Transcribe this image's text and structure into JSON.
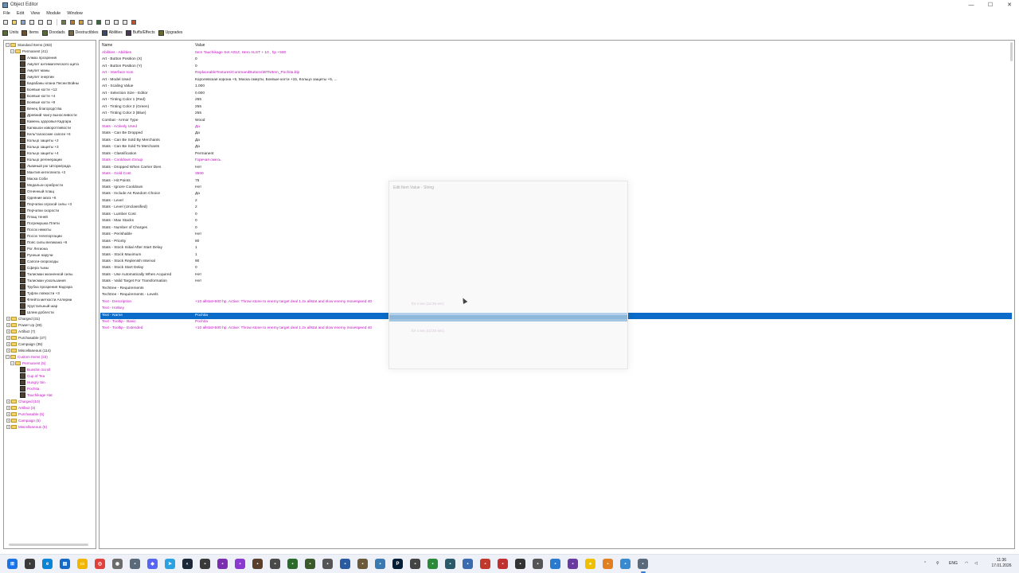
{
  "window": {
    "title": "Object Editor",
    "minimize": "—",
    "maximize": "☐",
    "close": "✕"
  },
  "menu": [
    "File",
    "Edit",
    "View",
    "Module",
    "Window"
  ],
  "object_tabs": [
    "Units",
    "Items",
    "Doodads",
    "Destructibles",
    "Abilities",
    "Buffs/Effects",
    "Upgrades"
  ],
  "tree": {
    "standard_root": "Standard Items (283)",
    "permanent_group": "Permanent (41)",
    "permanent_items": [
      "Алмаз прозрения",
      "Амулет антимагического щита",
      "Амулет маны",
      "Амулет энергии",
      "Барабаны клана Песни Войны",
      "Боевые когти +12",
      "Боевые когти +4",
      "Боевые когти +8",
      "Венец благородства",
      "Древний чангу выносливости",
      "Камень здоровья Кадгара",
      "Капюшон изворотливости",
      "Кель'таласские сапоги +6",
      "Кольцо защиты +2",
      "Кольцо защиты +3",
      "Кольцо защиты +4",
      "Кольцо регенерации",
      "Львиный рог Штормграда",
      "Мантия интеллекта +3",
      "Маска Соби",
      "Медальон храбрости",
      "Огненный плащ",
      "Одеяние мага +6",
      "Перчатки огрской силы +3",
      "Перчатки скорости",
      "Плащ теней",
      "Погремушка Плети",
      "Посох немоты",
      "Посох телепортации",
      "Пояс силы великана +6",
      "Рог Легиона",
      "Рунные наручи",
      "Сапоги-скороходы",
      "Сфера тьмы",
      "Талисман жизненной силы",
      "Талисман ускользания",
      "Трубка прозрения Кадгара",
      "Туфли ловкости +3",
      "Флейта меткости Аллерии",
      "Хрустальный шар",
      "Шлем доблести"
    ],
    "standard_groups": [
      "Charged (31)",
      "Power Up (28)",
      "Artifact (7)",
      "Purchasable (27)",
      "Campaign (35)",
      "Miscellaneous (114)"
    ],
    "custom_root": "Custom Items (33)",
    "custom_permanent": "Permanent (5)",
    "custom_items": [
      "Bunshin Scroll",
      "Cup of Tea",
      "Hungry Sin",
      "Pochita",
      "Tauchikage Hat"
    ],
    "custom_groups": [
      "Charged (10)",
      "Artifact (3)",
      "Purchasable (5)",
      "Campaign (5)",
      "Miscellaneous (5)"
    ]
  },
  "grid": {
    "col_name": "Name",
    "col_value": "Value",
    "rows": [
      {
        "name": "Abilities - Abilities",
        "value": "Item Tauchikage Set A01Z, Hero ALST + 10 , hp +500",
        "mod": true
      },
      {
        "name": "Art - Button Position (X)",
        "value": "0",
        "mod": false
      },
      {
        "name": "Art - Button Position (Y)",
        "value": "0",
        "mod": false
      },
      {
        "name": "Art - Interface Icon",
        "value": "ReplaceableTextures\\CommandButtons\\BTNItem_Pochita.blp",
        "mod": true
      },
      {
        "name": "Art - Model Used",
        "value": "Королевская корона +5, Маска смерти, Боевые когти +15, Кольцо защиты +5, ...",
        "mod": false
      },
      {
        "name": "Art - Scaling Value",
        "value": "1.000",
        "mod": false
      },
      {
        "name": "Art - Selection Size - Editor",
        "value": "0.000",
        "mod": false
      },
      {
        "name": "Art - Tinting Color 1 (Red)",
        "value": "255",
        "mod": false
      },
      {
        "name": "Art - Tinting Color 2 (Green)",
        "value": "255",
        "mod": false
      },
      {
        "name": "Art - Tinting Color 3 (Blue)",
        "value": "255",
        "mod": false
      },
      {
        "name": "Combat - Armor Type",
        "value": "Wood",
        "mod": false
      },
      {
        "name": "Stats - Actively Used",
        "value": "Да",
        "mod": true
      },
      {
        "name": "Stats - Can Be Dropped",
        "value": "Да",
        "mod": false
      },
      {
        "name": "Stats - Can Be Sold By Merchants",
        "value": "Да",
        "mod": false
      },
      {
        "name": "Stats - Can Be Sold To Merchants",
        "value": "Да",
        "mod": false
      },
      {
        "name": "Stats - Classification",
        "value": "Permanent",
        "mod": false
      },
      {
        "name": "Stats - Cooldown Group",
        "value": "Горечая смесь",
        "mod": true
      },
      {
        "name": "Stats - Dropped When Carrier Dies",
        "value": "Нет",
        "mod": false
      },
      {
        "name": "Stats - Gold Cost",
        "value": "3500",
        "mod": true
      },
      {
        "name": "Stats - Hit Points",
        "value": "75",
        "mod": false
      },
      {
        "name": "Stats - Ignore Cooldown",
        "value": "Нет",
        "mod": false
      },
      {
        "name": "Stats - Include As Random Choice",
        "value": "Да",
        "mod": false
      },
      {
        "name": "Stats - Level",
        "value": "2",
        "mod": false
      },
      {
        "name": "Stats - Level (Unclassified)",
        "value": "2",
        "mod": false
      },
      {
        "name": "Stats - Lumber Cost",
        "value": "0",
        "mod": false
      },
      {
        "name": "Stats - Max Stacks",
        "value": "0",
        "mod": false
      },
      {
        "name": "Stats - Number of Charges",
        "value": "0",
        "mod": false
      },
      {
        "name": "Stats - Perishable",
        "value": "Нет",
        "mod": false
      },
      {
        "name": "Stats - Priority",
        "value": "80",
        "mod": false
      },
      {
        "name": "Stats - Stock Initial After Start Delay",
        "value": "1",
        "mod": false
      },
      {
        "name": "Stats - Stock Maximum",
        "value": "1",
        "mod": false
      },
      {
        "name": "Stats - Stock Replenish Interval",
        "value": "90",
        "mod": false
      },
      {
        "name": "Stats - Stock Start Delay",
        "value": "0",
        "mod": false
      },
      {
        "name": "Stats - Use Automatically When Acquired",
        "value": "Нет",
        "mod": false
      },
      {
        "name": "Stats - Valid Target For Transformation",
        "value": "Нет",
        "mod": false
      },
      {
        "name": "Techtree - Requirements",
        "value": "",
        "mod": false
      },
      {
        "name": "Techtree - Requirements - Levels",
        "value": "",
        "mod": false
      },
      {
        "name": "Text - Description",
        "value": "+10 allstat+500 hp. Active: Throw stone to enemy target deal 1.2x allstat and slow enemy movespeed 40",
        "mod": true
      },
      {
        "name": "Text - Hotkey",
        "value": "",
        "mod": true
      },
      {
        "name": "Text - Name",
        "value": "Pochita",
        "mod": true,
        "selected": true
      },
      {
        "name": "Text - Tooltip - Basic",
        "value": "Pochita",
        "mod": true
      },
      {
        "name": "Text - Tooltip - Extended",
        "value": "+10 allstat+500 hp. Active: Throw stone to enemy target deal 1.2x allstat and slow enemy movespeed 40",
        "mod": true
      }
    ]
  },
  "dialog": {
    "title": "Edit Item Value - String",
    "ghost_line_1": "for 4 sec (cd 25 sec)",
    "ghost_line_2": "for 4 sec (cd 25 sec)"
  },
  "taskbar": {
    "language": "ENG",
    "time": "11:36",
    "date": "17.01.2026"
  }
}
